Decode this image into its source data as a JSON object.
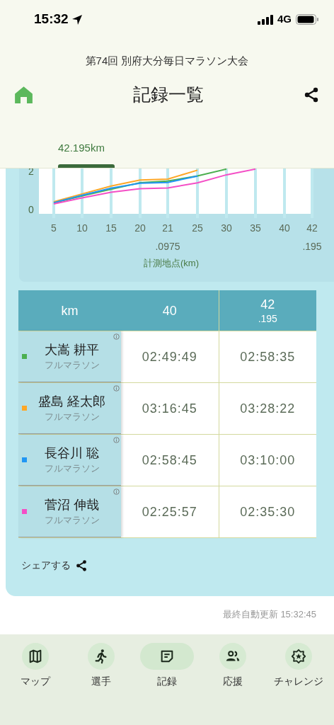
{
  "status_bar": {
    "time": "15:32",
    "network": "4G"
  },
  "header": {
    "event_title": "第74回 別府大分毎日マラソン大会",
    "title": "記録一覧"
  },
  "tabs": [
    {
      "label": "42.195km",
      "selected": true
    }
  ],
  "chart_data": {
    "type": "line",
    "xlabel": "計測地点(km)",
    "categories": [
      "5",
      "10",
      "15",
      "20",
      "21\n.0975",
      "25",
      "30",
      "35",
      "40",
      "42\n.195"
    ],
    "ylim": [
      -0.22,
      2.15
    ],
    "yticks": [
      0,
      2
    ],
    "grid": true,
    "series": [
      {
        "color": "#4caf50",
        "values": [
          0.35,
          0.71,
          1.06,
          1.41,
          1.49,
          1.76,
          2.12,
          null,
          null,
          null
        ]
      },
      {
        "color": "#ffa726",
        "values": [
          0.41,
          0.82,
          1.23,
          1.55,
          1.6,
          2.06,
          null,
          null,
          null,
          null
        ]
      },
      {
        "color": "#2196f3",
        "values": [
          0.37,
          0.75,
          1.12,
          1.38,
          1.42,
          1.75,
          null,
          null,
          null,
          null
        ]
      },
      {
        "color": "#f44fc6",
        "values": [
          0.3,
          0.61,
          0.91,
          1.1,
          1.13,
          1.4,
          1.82,
          2.12,
          null,
          null
        ]
      }
    ]
  },
  "table": {
    "columns": [
      {
        "label": "km"
      },
      {
        "label": "40"
      },
      {
        "label": "42",
        "sub": ".195"
      }
    ],
    "rows": [
      {
        "name": "大嵩 耕平",
        "category": "フルマラソン",
        "color": "#4caf50",
        "times": [
          "02:49:49",
          "02:58:35"
        ]
      },
      {
        "name": "盛島 経太郎",
        "category": "フルマラソン",
        "color": "#ffa726",
        "times": [
          "03:16:45",
          "03:28:22"
        ]
      },
      {
        "name": "長谷川 聡",
        "category": "フルマラソン",
        "color": "#2196f3",
        "times": [
          "02:58:45",
          "03:10:00"
        ]
      },
      {
        "name": "菅沼 伸哉",
        "category": "フルマラソン",
        "color": "#f44fc6",
        "times": [
          "02:25:57",
          "02:35:30"
        ]
      }
    ]
  },
  "share_label": "シェアする",
  "last_update": "最終自動更新 15:32:45",
  "nav": [
    {
      "label": "マップ",
      "selected": false
    },
    {
      "label": "選手",
      "selected": false
    },
    {
      "label": "記録",
      "selected": true
    },
    {
      "label": "応援",
      "selected": false
    },
    {
      "label": "チャレンジ",
      "selected": false
    }
  ]
}
